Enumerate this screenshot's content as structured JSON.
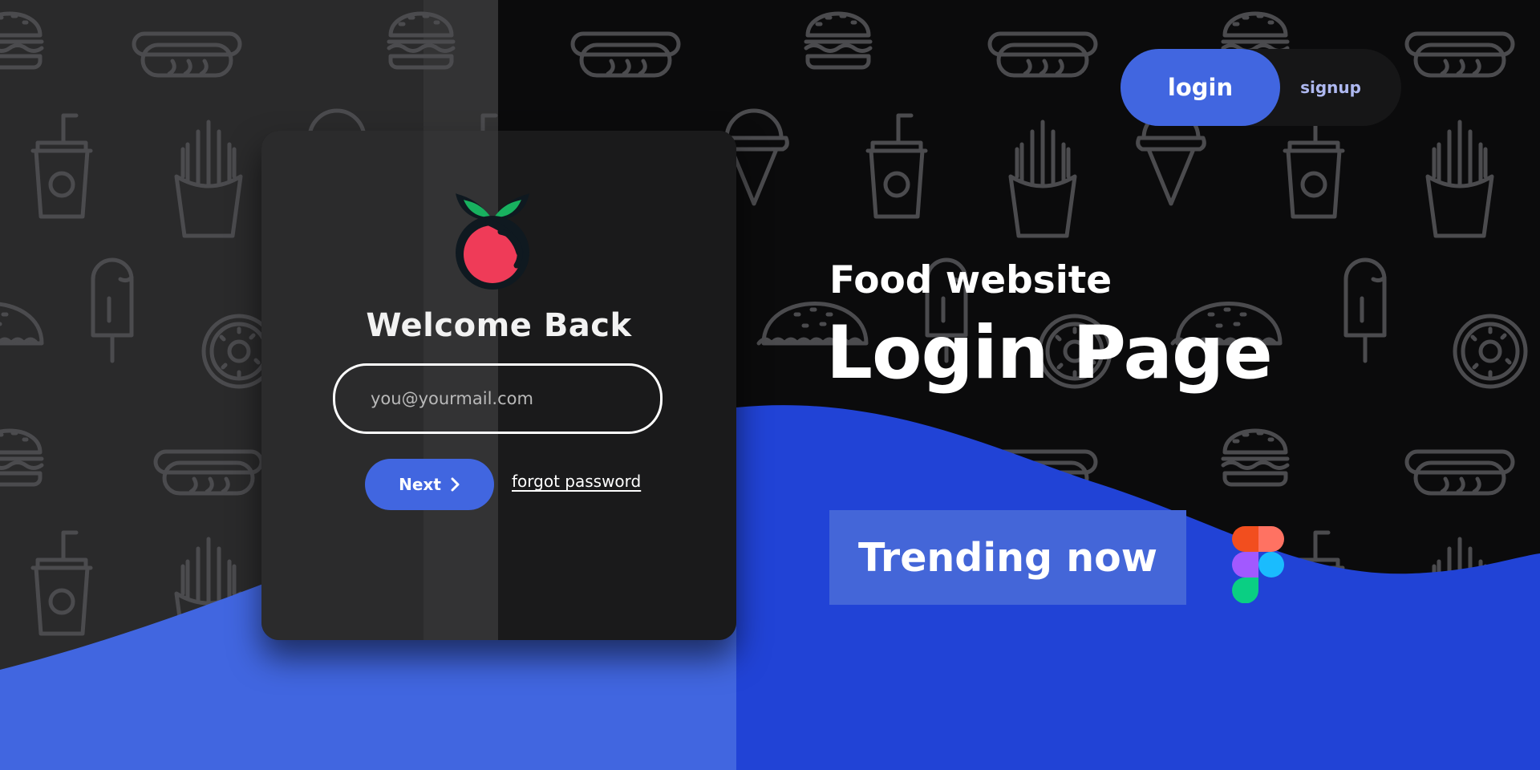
{
  "card": {
    "heading": "Welcome Back",
    "email_placeholder": "you@yourmail.com",
    "next_label": "Next",
    "forgot_label": "forgot password"
  },
  "auth_toggle": {
    "login_label": "login",
    "signup_label": "signup"
  },
  "promo": {
    "subtitle": "Food website",
    "title": "Login Page",
    "badge": "Trending now"
  },
  "icons": {
    "brand": "cherry-logo-icon",
    "next": "chevron-right-icon",
    "design_tool": "figma-logo-icon",
    "pattern": [
      "burger-icon",
      "hotdog-icon",
      "soda-cup-icon",
      "fries-icon",
      "taco-icon",
      "donut-icon",
      "popsicle-icon",
      "ice-cream-cone-icon"
    ]
  },
  "colors": {
    "accent": "#4166e0",
    "wave": "#2143d6",
    "background": "#0b0b0c",
    "cherry": "#ef3b58",
    "leaf": "#18b15f"
  }
}
